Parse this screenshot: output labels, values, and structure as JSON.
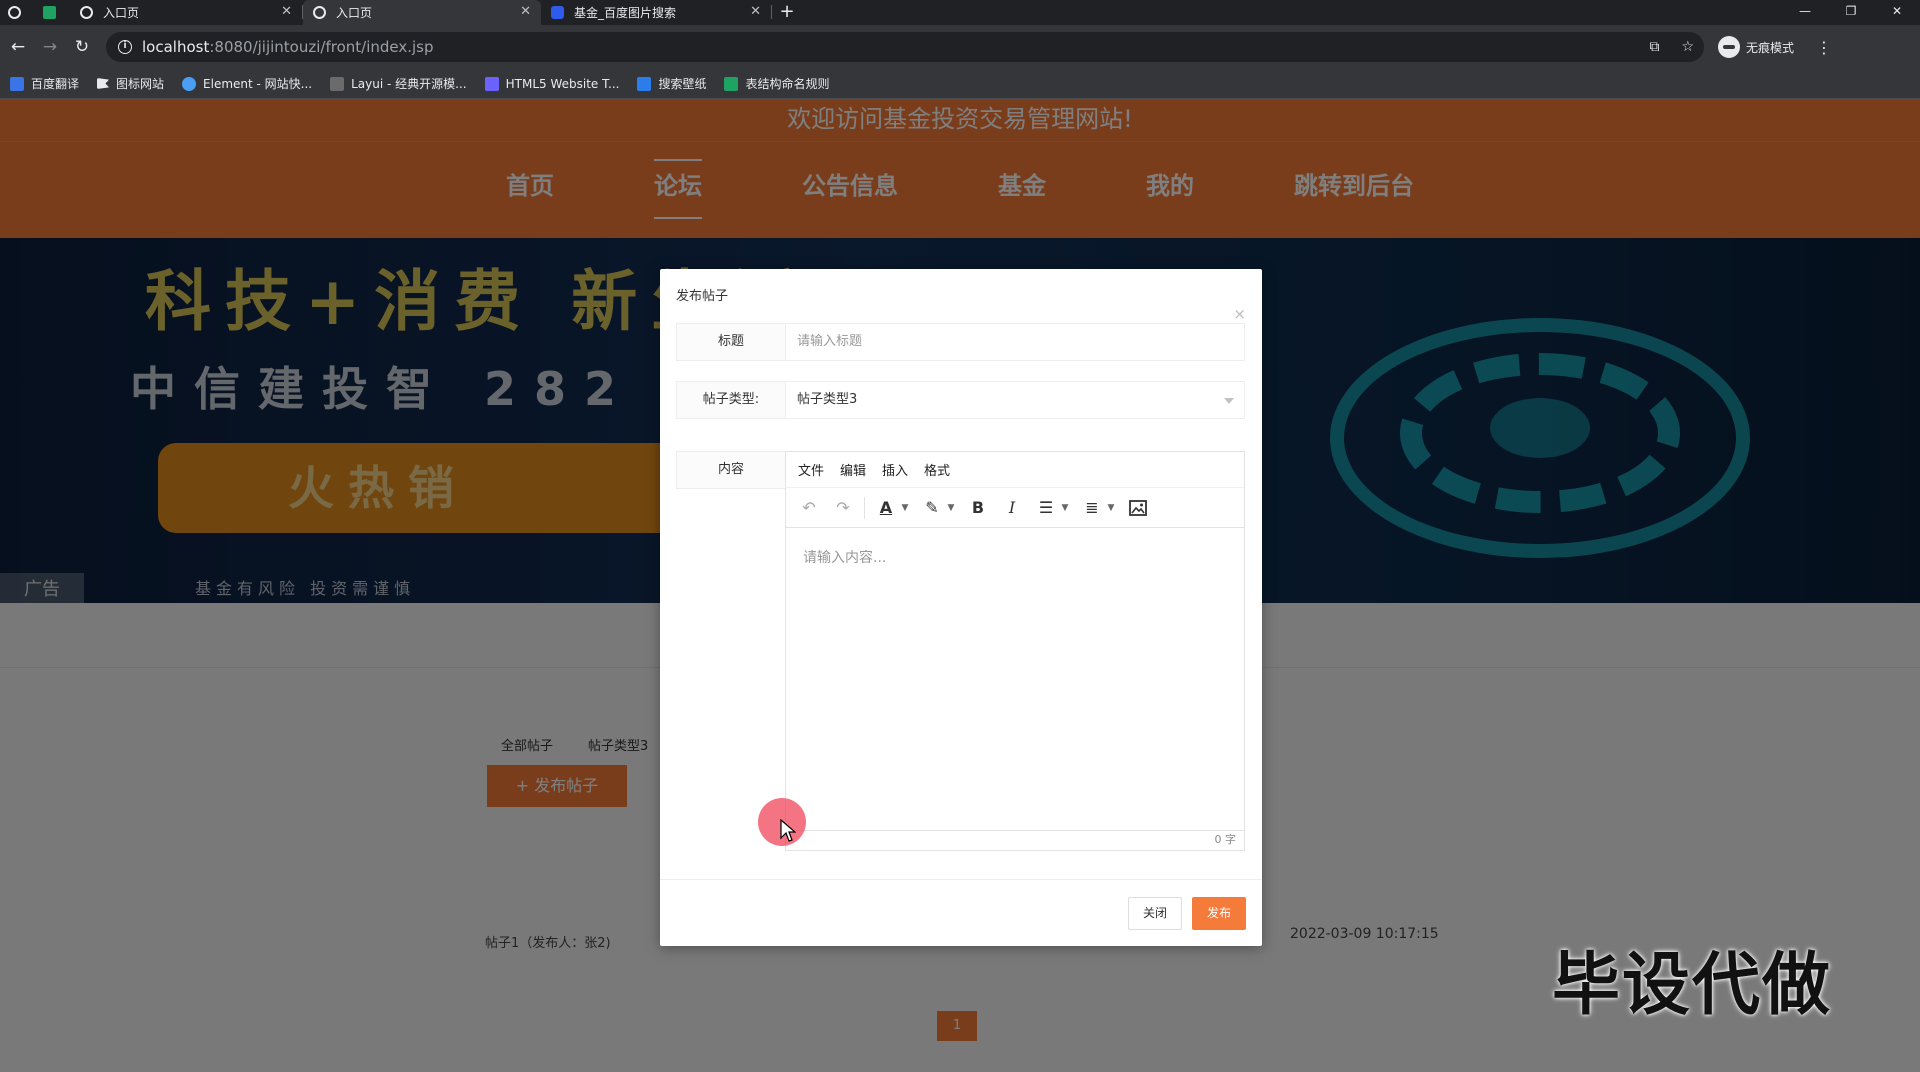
{
  "browser": {
    "tabs": [
      {
        "title": "",
        "favicon": "globe-icon"
      },
      {
        "title": "",
        "favicon": "sheet-icon"
      },
      {
        "title": "入口页",
        "favicon": "globe-icon"
      },
      {
        "title": "入口页",
        "favicon": "globe-icon"
      },
      {
        "title": "基金_百度图片搜索",
        "favicon": "baidu-paw-icon"
      }
    ],
    "url_host": "localhost",
    "url_rest": ":8080/jijintouzi/front/index.jsp",
    "profile_label": "无痕模式",
    "bookmarks": [
      "百度翻译",
      "图标网站",
      "Element - 网站快...",
      "Layui - 经典开源模...",
      "HTML5 Website T...",
      "搜索壁纸",
      "表结构命名规则"
    ]
  },
  "site": {
    "welcome": "欢迎访问基金投资交易管理网站!",
    "nav": [
      "首页",
      "论坛",
      "公告信息",
      "基金",
      "我的",
      "跳转到后台"
    ],
    "active_nav": "论坛",
    "colors": {
      "brand": "#f47b39"
    }
  },
  "banner": {
    "line1": "科技+消费 新生活",
    "line2": "中信建投智 282",
    "button_text": "火热销",
    "ad_label": "广告",
    "note": "基金有风险 投资需谨慎"
  },
  "forum": {
    "filter_all": "全部帖子",
    "filter_type": "帖子类型3",
    "post_button": "+ 发布帖子",
    "post_title": "帖子1（发布人：张2)",
    "post_date": "2022-03-09 10:17:15",
    "current_page": "1"
  },
  "watermark": "毕设代做",
  "modal": {
    "title": "发布帖子",
    "close_icon": "×",
    "title_label": "标题",
    "title_placeholder": "请输入标题",
    "type_label": "帖子类型:",
    "type_value": "帖子类型3",
    "content_label": "内容",
    "editor_menus": [
      "文件",
      "编辑",
      "插入",
      "格式"
    ],
    "editor_placeholder": "请输入内容...",
    "word_count": "0 字",
    "close_button": "关闭",
    "publish_button": "发布"
  }
}
